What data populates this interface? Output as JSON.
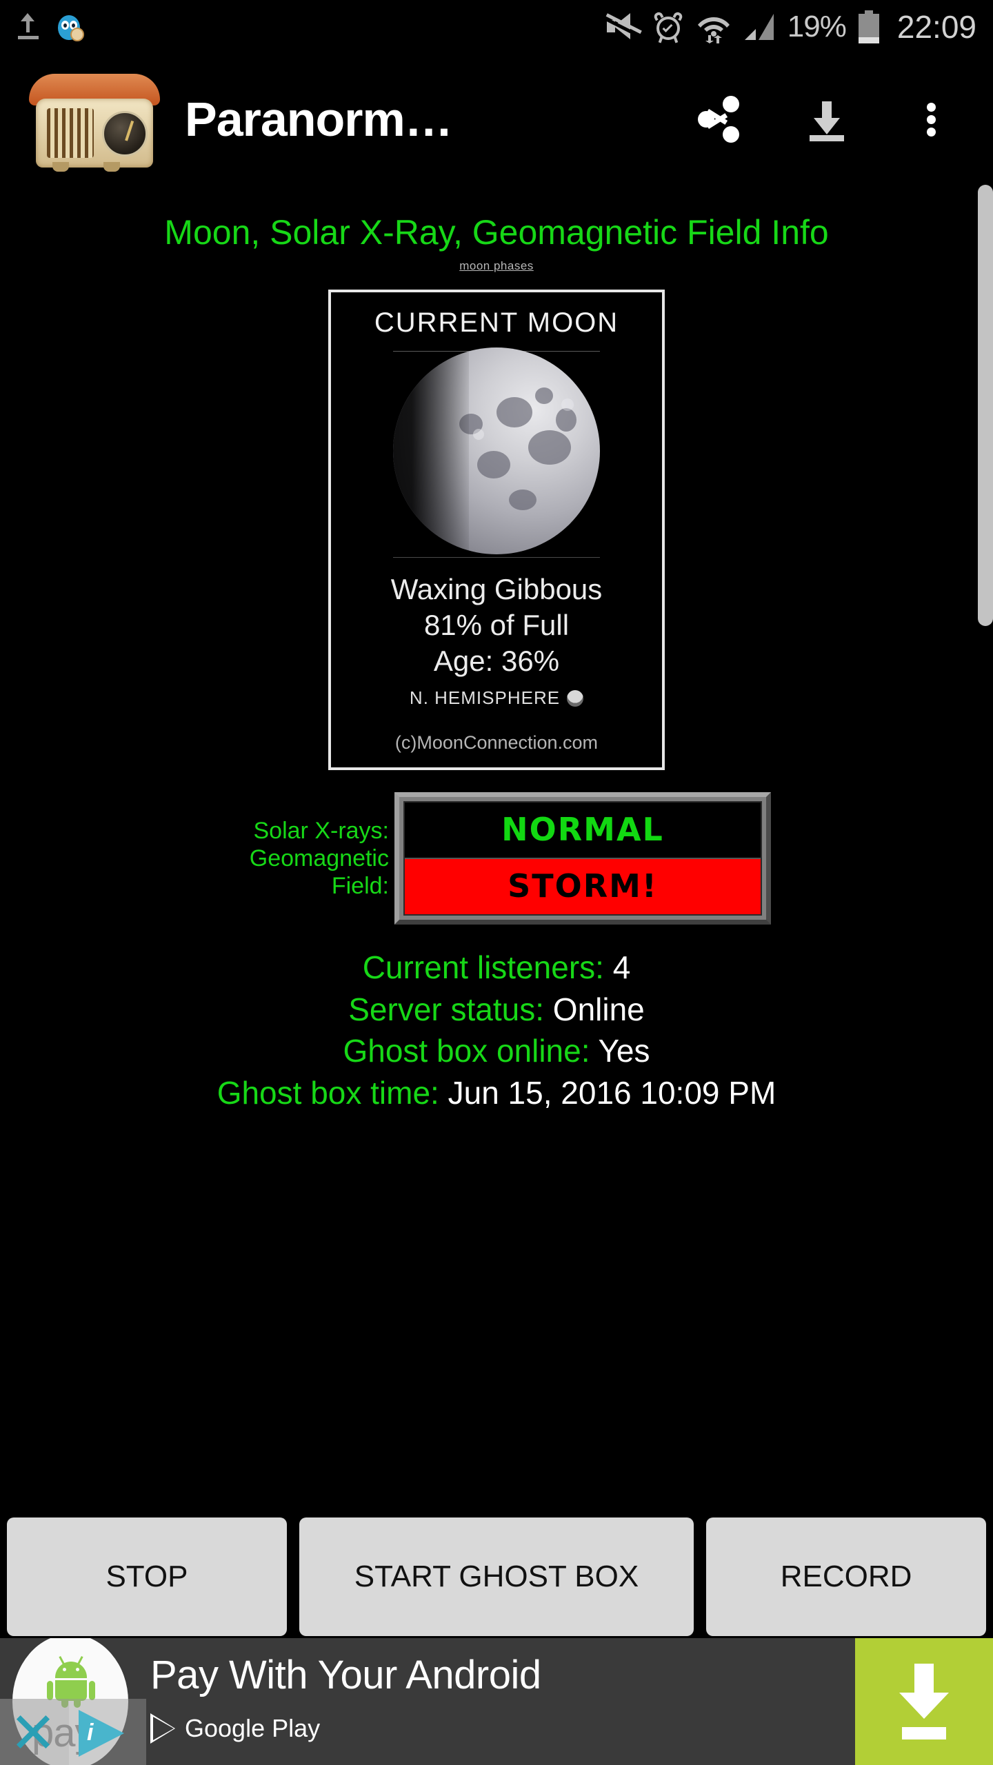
{
  "status_bar": {
    "notifications": [
      "upload-icon",
      "twitter-bird-icon"
    ],
    "icons": [
      "mute-icon",
      "alarm-icon",
      "wifi-icon",
      "cellular-signal-icon",
      "battery-icon"
    ],
    "battery_percent": "19%",
    "time": "22:09"
  },
  "app_bar": {
    "logo": "vintage-radio-icon",
    "title": "Paranorm…",
    "actions": [
      {
        "name": "share-icon",
        "label": "Share"
      },
      {
        "name": "download-icon",
        "label": "Download"
      },
      {
        "name": "overflow-menu-icon",
        "label": "More options"
      }
    ]
  },
  "content": {
    "section_title": "Moon, Solar X-Ray, Geomagnetic Field Info",
    "moon_phases_link": "moon phases",
    "moon_card": {
      "title": "CURRENT MOON",
      "phase": "Waxing Gibbous",
      "illumination": "81% of Full",
      "age": "Age: 36%",
      "hemisphere": "N. HEMISPHERE",
      "credit": "(c)MoonConnection.com"
    },
    "space_weather": {
      "xray_label": "Solar X-rays:",
      "geo_label_line1": "Geomagnetic",
      "geo_label_line2": "Field:",
      "xray_status": "NORMAL",
      "geo_status": "STORM!",
      "xray_color": "#12d812",
      "geo_bg_color": "#ff0000"
    },
    "status": [
      {
        "label": "Current listeners:",
        "value": "4"
      },
      {
        "label": "Server status:",
        "value": "Online"
      },
      {
        "label": "Ghost box online:",
        "value": "Yes"
      },
      {
        "label": "Ghost box time:",
        "value": "Jun 15, 2016 10:09 PM"
      }
    ]
  },
  "buttons": {
    "stop": "STOP",
    "start_ghost_box": "START GHOST BOX",
    "record": "RECORD"
  },
  "ad": {
    "brand_mark": "android-pay-logo",
    "pay_text": "pay",
    "headline": "Pay With Your Android",
    "store": "Google Play",
    "cta_icon": "download-arrow-icon",
    "close_icon": "close-x-icon",
    "adchoices_icon": "adchoices-icon"
  },
  "theme": {
    "background": "#000000",
    "accent_green": "#17d817",
    "text_white": "#ffffff",
    "button_bg": "#d9d9d9",
    "ad_bg": "#3a3a3a",
    "cta_bg": "#b2cf36"
  }
}
